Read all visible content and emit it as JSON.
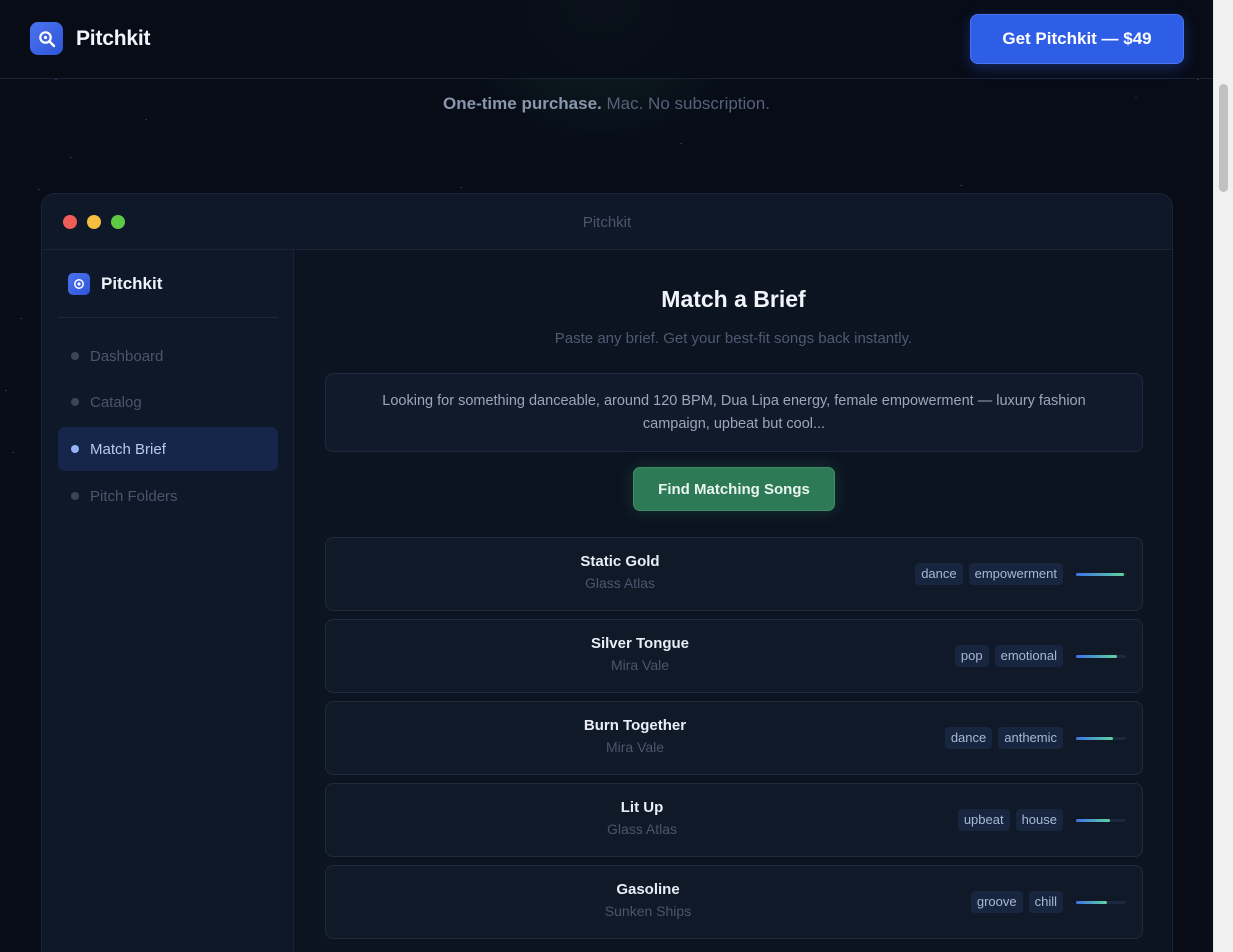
{
  "header": {
    "brand_name": "Pitchkit",
    "buy_button": "Get Pitchkit — $49"
  },
  "tagline": {
    "bold": "One-time purchase.",
    "rest": " Mac. No subscription."
  },
  "window": {
    "title": "Pitchkit"
  },
  "sidebar": {
    "brand_name": "Pitchkit",
    "items": [
      {
        "label": "Dashboard"
      },
      {
        "label": "Catalog"
      },
      {
        "label": "Match Brief"
      },
      {
        "label": "Pitch Folders"
      }
    ],
    "active": "Match Brief"
  },
  "main": {
    "title": "Match a Brief",
    "subtitle": "Paste any brief. Get your best-fit songs back instantly.",
    "brief_text": "Looking for something danceable, around 120 BPM, Dua Lipa energy, female empowerment — luxury fashion campaign, upbeat but cool...",
    "find_button": "Find Matching Songs"
  },
  "results": [
    {
      "title": "Static Gold",
      "artist": "Glass Atlas",
      "tags": [
        "dance",
        "empowerment"
      ],
      "match": 0.95
    },
    {
      "title": "Silver Tongue",
      "artist": "Mira Vale",
      "tags": [
        "pop",
        "emotional"
      ],
      "match": 0.82
    },
    {
      "title": "Burn Together",
      "artist": "Mira Vale",
      "tags": [
        "dance",
        "anthemic"
      ],
      "match": 0.74
    },
    {
      "title": "Lit Up",
      "artist": "Glass Atlas",
      "tags": [
        "upbeat",
        "house"
      ],
      "match": 0.68
    },
    {
      "title": "Gasoline",
      "artist": "Sunken Ships",
      "tags": [
        "groove",
        "chill"
      ],
      "match": 0.62
    }
  ],
  "colors": {
    "accent": "#2f5ee6",
    "action": "#2e7a56",
    "background": "#070c17"
  }
}
